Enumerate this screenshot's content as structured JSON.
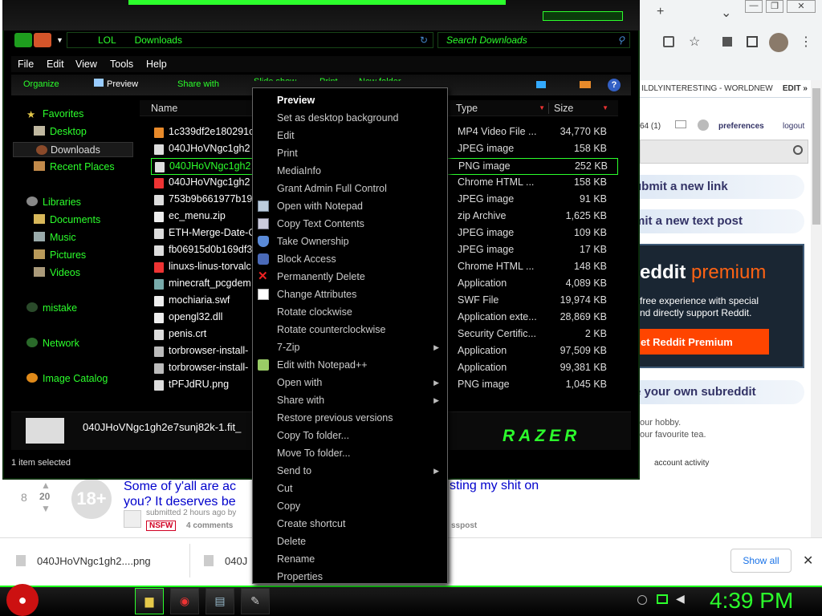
{
  "browser": {
    "new_tab": "+",
    "chevron": "⌄",
    "win_min": "—",
    "win_max": "❐",
    "win_close": "✕",
    "ruler_text": "ILDLYINTERESTING - WORLDNEW",
    "edit_label": "EDIT »",
    "user_score": "64 (1)",
    "preferences": "preferences",
    "logout": "logout",
    "submit_link": "ubmit a new link",
    "submit_text": "mit a new text post",
    "premium_word": "eddit",
    "premium_brand": "premium",
    "premium_desc1": "free experience with special",
    "premium_desc2": "nd directly support Reddit.",
    "premium_button": "et Reddit Premium",
    "create_sub": "e your own subreddit",
    "hobby1": "our hobby.",
    "hobby2": "our favourite tea.",
    "account_activity": "account activity"
  },
  "post": {
    "rank": "8",
    "votes": "20",
    "thumb_label": "18+",
    "title_left": "Some of y'all are ac",
    "title_left2": "you? It deserves be",
    "title_right": "sting my shit on",
    "submitted": "submitted 2 hours ago by",
    "nsfw": "NSFW",
    "comments": "4 comments",
    "repost": "sspost"
  },
  "downloads": {
    "item1": "040JHoVNgc1gh2....png",
    "item2": "040J",
    "show_all": "Show all",
    "close": "✕"
  },
  "taskbar": {
    "clock": "4:39 PM"
  },
  "explorer": {
    "breadcrumb_1": "LOL",
    "breadcrumb_2": "Downloads",
    "search_placeholder": "Search Downloads",
    "menu": [
      "File",
      "Edit",
      "View",
      "Tools",
      "Help"
    ],
    "commands": [
      "Organize",
      "Preview",
      "Share with",
      "Slide show",
      "Print",
      "New folder"
    ],
    "nav": {
      "favorites": "Favorites",
      "desktop": "Desktop",
      "downloads": "Downloads",
      "recent": "Recent Places",
      "libraries": "Libraries",
      "documents": "Documents",
      "music": "Music",
      "pictures": "Pictures",
      "videos": "Videos",
      "mistake": "mistake",
      "network": "Network",
      "image_catalog": "Image Catalog"
    },
    "columns": {
      "name": "Name",
      "type": "Type",
      "size": "Size"
    },
    "files": [
      {
        "name": "1c339df2e180291c",
        "type": "MP4 Video File ...",
        "size": "34,770 KB"
      },
      {
        "name": "040JHoVNgc1gh2",
        "type": "JPEG image",
        "size": "158 KB"
      },
      {
        "name": "040JHoVNgc1gh2",
        "type": "PNG image",
        "size": "252 KB"
      },
      {
        "name": "040JHoVNgc1gh2",
        "type": "Chrome HTML ...",
        "size": "158 KB"
      },
      {
        "name": "753b9b661977b19",
        "type": "JPEG image",
        "size": "91 KB"
      },
      {
        "name": "ec_menu.zip",
        "type": "zip Archive",
        "size": "1,625 KB"
      },
      {
        "name": "ETH-Merge-Date-C",
        "type": "JPEG image",
        "size": "109 KB"
      },
      {
        "name": "fb06915d0b169df3",
        "type": "JPEG image",
        "size": "17 KB"
      },
      {
        "name": "linuxs-linus-torvalc",
        "type": "Chrome HTML ...",
        "size": "148 KB"
      },
      {
        "name": "minecraft_pcgdem",
        "type": "Application",
        "size": "4,089 KB"
      },
      {
        "name": "mochiaria.swf",
        "type": "SWF File",
        "size": "19,974 KB"
      },
      {
        "name": "opengl32.dll",
        "type": "Application exte...",
        "size": "28,869 KB"
      },
      {
        "name": "penis.crt",
        "type": "Security Certific...",
        "size": "2 KB"
      },
      {
        "name": "torbrowser-install-",
        "type": "Application",
        "size": "97,509 KB"
      },
      {
        "name": "torbrowser-install-",
        "type": "Application",
        "size": "99,381 KB"
      },
      {
        "name": "tPFJdRU.png",
        "type": "PNG image",
        "size": "1,045 KB"
      }
    ],
    "details_name": "040JHoVNgc1gh2e7sunj82k-1.fit_",
    "razer": "RAZER",
    "status": "1 item selected"
  },
  "context_menu": [
    {
      "label": "Preview",
      "bold": true
    },
    {
      "label": "Set as desktop background"
    },
    {
      "label": "Edit"
    },
    {
      "label": "Print"
    },
    {
      "label": "MediaInfo"
    },
    {
      "label": "Grant Admin Full Control"
    },
    {
      "label": "Open with Notepad",
      "icon": "notepad-icon"
    },
    {
      "label": "Copy Text Contents",
      "icon": "copy-icon"
    },
    {
      "label": "Take Ownership",
      "icon": "shield-icon"
    },
    {
      "label": "Block Access",
      "icon": "lock-icon"
    },
    {
      "label": "Permanently Delete",
      "icon": "delete-x-icon"
    },
    {
      "label": "Change Attributes",
      "icon": "checkbox-icon"
    },
    {
      "label": "Rotate clockwise"
    },
    {
      "label": "Rotate counterclockwise"
    },
    {
      "label": "7-Zip",
      "submenu": true
    },
    {
      "label": "Edit with Notepad++",
      "icon": "notepadpp-icon"
    },
    {
      "label": "Open with",
      "submenu": true
    },
    {
      "label": "Share with",
      "submenu": true
    },
    {
      "label": "Restore previous versions"
    },
    {
      "label": "Copy To folder..."
    },
    {
      "label": "Move To folder..."
    },
    {
      "label": "Send to",
      "submenu": true
    },
    {
      "label": "Cut"
    },
    {
      "label": "Copy"
    },
    {
      "label": "Create shortcut"
    },
    {
      "label": "Delete"
    },
    {
      "label": "Rename"
    },
    {
      "label": "Properties"
    }
  ]
}
